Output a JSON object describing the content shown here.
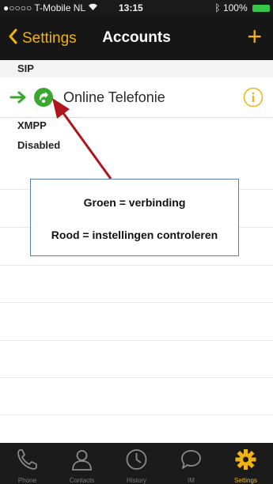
{
  "status_bar": {
    "carrier": "●○○○○ T-Mobile NL",
    "time": "13:15",
    "battery": "100%"
  },
  "nav": {
    "back_label": "Settings",
    "title": "Accounts",
    "add_symbol": "+"
  },
  "sections": {
    "sip": {
      "header": "SIP",
      "account_name": "Online Telefonie",
      "status_color": "#3aa82f"
    },
    "xmpp": {
      "header": "XMPP",
      "status": "Disabled"
    }
  },
  "callout": {
    "line1": "Groen = verbinding",
    "line2": "Rood = instellingen controleren"
  },
  "tabs": [
    {
      "label": "Phone",
      "icon": "phone-icon"
    },
    {
      "label": "Contacts",
      "icon": "contacts-icon"
    },
    {
      "label": "History",
      "icon": "clock-icon"
    },
    {
      "label": "IM",
      "icon": "chat-icon"
    },
    {
      "label": "Settings",
      "icon": "gear-icon",
      "active": true
    }
  ],
  "colors": {
    "accent": "#f0b30f",
    "status_green": "#3aa82f",
    "annotation_red": "#b0151c"
  }
}
